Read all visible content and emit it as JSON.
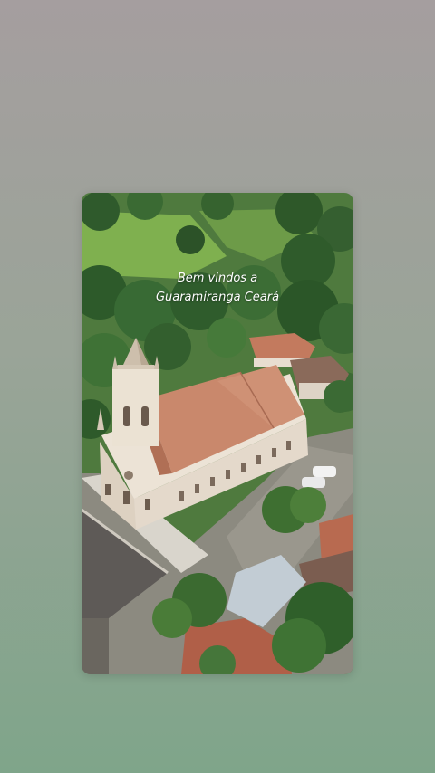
{
  "story": {
    "caption_line1": "Bem vindos a",
    "caption_line2": "Guaramiranga Ceará"
  },
  "colors": {
    "background_top": "#a59e9f",
    "background_bottom": "#7fa58a",
    "roof": "#c9886c",
    "church_wall": "#ece3d6"
  }
}
